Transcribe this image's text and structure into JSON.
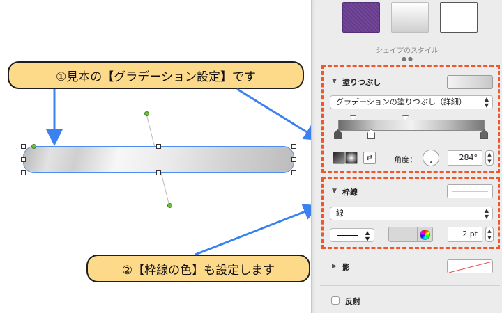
{
  "callouts": {
    "gradient_sample": "①見本の【グラデーション設定】です",
    "stroke_color": "②【枠線の色】も設定します"
  },
  "inspector": {
    "style_section": {
      "label": "シェイプのスタイル",
      "swatches": [
        "purple-texture",
        "gray-gradient",
        "white-outline"
      ]
    },
    "fill": {
      "title": "塗りつぶし",
      "fill_type": "グラデーションの塗りつぶし（詳細）",
      "angle_label": "角度：",
      "angle_value": "284°"
    },
    "stroke": {
      "title": "枠線",
      "stroke_type": "線",
      "width_value": "2 pt"
    },
    "shadow": {
      "title": "影"
    },
    "reflection": {
      "title": "反射"
    }
  },
  "colors": {
    "callout_fill": "#fdd98a",
    "highlight_dash": "#f0562a",
    "arrow_blue": "#3b82f0",
    "selection_blue": "#4d8df2"
  }
}
